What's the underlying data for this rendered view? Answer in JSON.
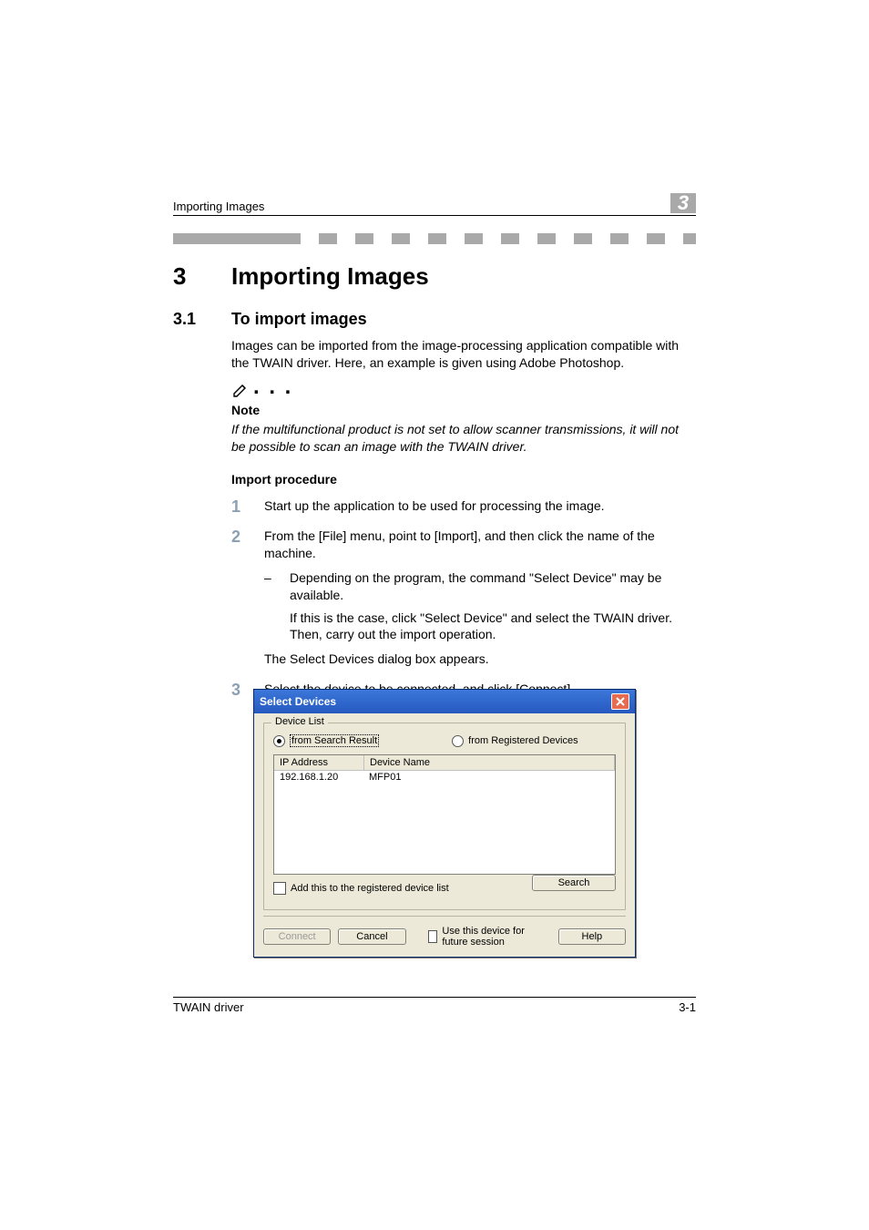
{
  "running_head": {
    "title": "Importing Images",
    "chapter_number": "3"
  },
  "chapter": {
    "number": "3",
    "title": "Importing Images"
  },
  "section": {
    "number": "3.1",
    "title": "To import images"
  },
  "intro_paragraph": "Images can be imported from the image-processing application compatible with the TWAIN driver. Here, an example is given using Adobe Photoshop.",
  "note": {
    "label": "Note",
    "text": "If the multifunctional product is not set to allow scanner transmissions, it will not be possible to scan an image with the TWAIN driver."
  },
  "import_procedure_label": "Import procedure",
  "steps": {
    "s1": {
      "n": "1",
      "text": "Start up the application to be used for processing the image."
    },
    "s2": {
      "n": "2",
      "text": "From the [File] menu, point to [Import], and then click the name of the machine.",
      "sub_dash": "–",
      "sub_text_a": "Depending on the program, the command \"Select Device\" may be available.",
      "sub_text_b": "If this is the case, click \"Select Device\" and select the TWAIN driver. Then, carry out the import operation.",
      "after": "The Select Devices dialog box appears."
    },
    "s3": {
      "n": "3",
      "text": "Select the device to be connected, and click [Connect]."
    }
  },
  "dialog": {
    "title": "Select Devices",
    "group_legend": "Device List",
    "radio_search": "from Search Result",
    "radio_registered": "from Registered Devices",
    "col_ip": "IP Address",
    "col_name": "Device Name",
    "row_ip": "192.168.1.20",
    "row_name": "MFP01",
    "add_registered": "Add this to the registered device list",
    "search_btn": "Search",
    "connect_btn": "Connect",
    "cancel_btn": "Cancel",
    "use_future": "Use this device for future session",
    "help_btn": "Help"
  },
  "footer": {
    "left": "TWAIN driver",
    "right": "3-1"
  }
}
